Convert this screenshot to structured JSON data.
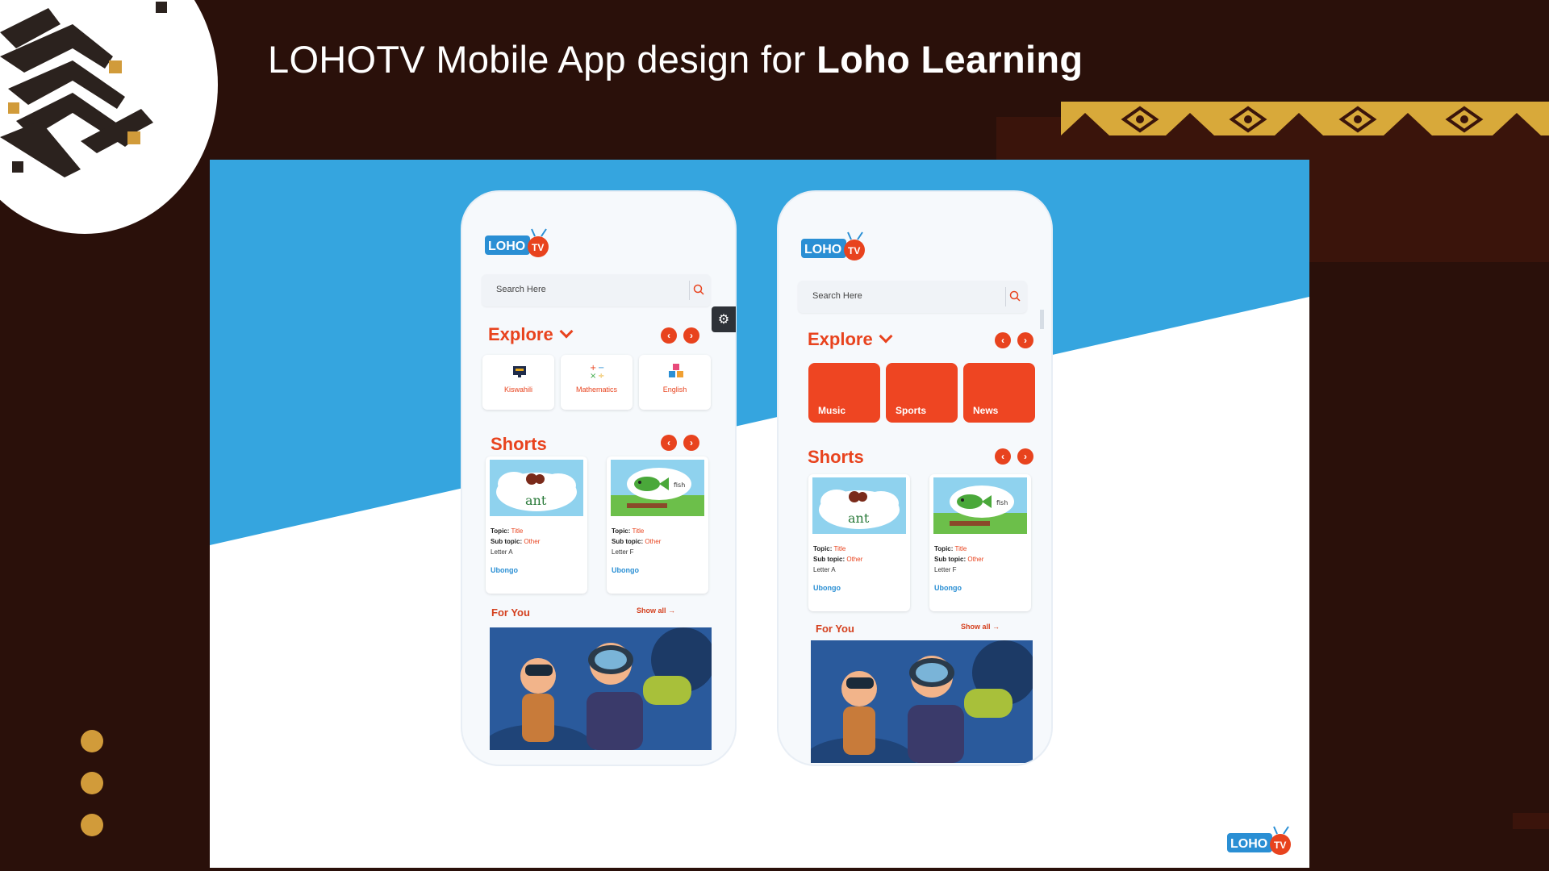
{
  "header": {
    "title_prefix": "LOHOTV Mobile App design for ",
    "title_bold": "Loho Learning"
  },
  "brand": {
    "logo_text": "LOHO",
    "logo_tv": "TV",
    "accent": "#e8431e",
    "blue": "#35a5df",
    "background": "#2a100a",
    "gold": "#d19b3a"
  },
  "phone1": {
    "search_placeholder": "Search Here",
    "explore_title": "Explore",
    "categories": [
      {
        "label": "Kiswahili",
        "icon": "book-icon"
      },
      {
        "label": "Mathematics",
        "icon": "math-icon"
      },
      {
        "label": "English",
        "icon": "blocks-icon"
      }
    ],
    "shorts_title": "Shorts",
    "shorts": [
      {
        "topic_label": "Topic:",
        "topic": "Title",
        "subtopic_label": "Sub topic:",
        "subtopic": "Other",
        "letter": "Letter A",
        "brand": "Ubongo",
        "thumb_word": "ant"
      },
      {
        "topic_label": "Topic:",
        "topic": "Title",
        "subtopic_label": "Sub topic:",
        "subtopic": "Other",
        "letter": "Letter F",
        "brand": "Ubongo",
        "thumb_word": "fish"
      }
    ],
    "for_you_title": "For You",
    "show_all": "Show all →"
  },
  "phone2": {
    "search_placeholder": "Search Here",
    "explore_title": "Explore",
    "categories": [
      {
        "label": "Music"
      },
      {
        "label": "Sports"
      },
      {
        "label": "News"
      }
    ],
    "shorts_title": "Shorts",
    "shorts": [
      {
        "topic_label": "Topic:",
        "topic": "Title",
        "subtopic_label": "Sub topic:",
        "subtopic": "Other",
        "letter": "Letter A",
        "brand": "Ubongo",
        "thumb_word": "ant"
      },
      {
        "topic_label": "Topic:",
        "topic": "Title",
        "subtopic_label": "Sub topic:",
        "subtopic": "Other",
        "letter": "Letter F",
        "brand": "Ubongo",
        "thumb_word": "fish"
      }
    ],
    "for_you_title": "For You",
    "show_all": "Show all →"
  }
}
